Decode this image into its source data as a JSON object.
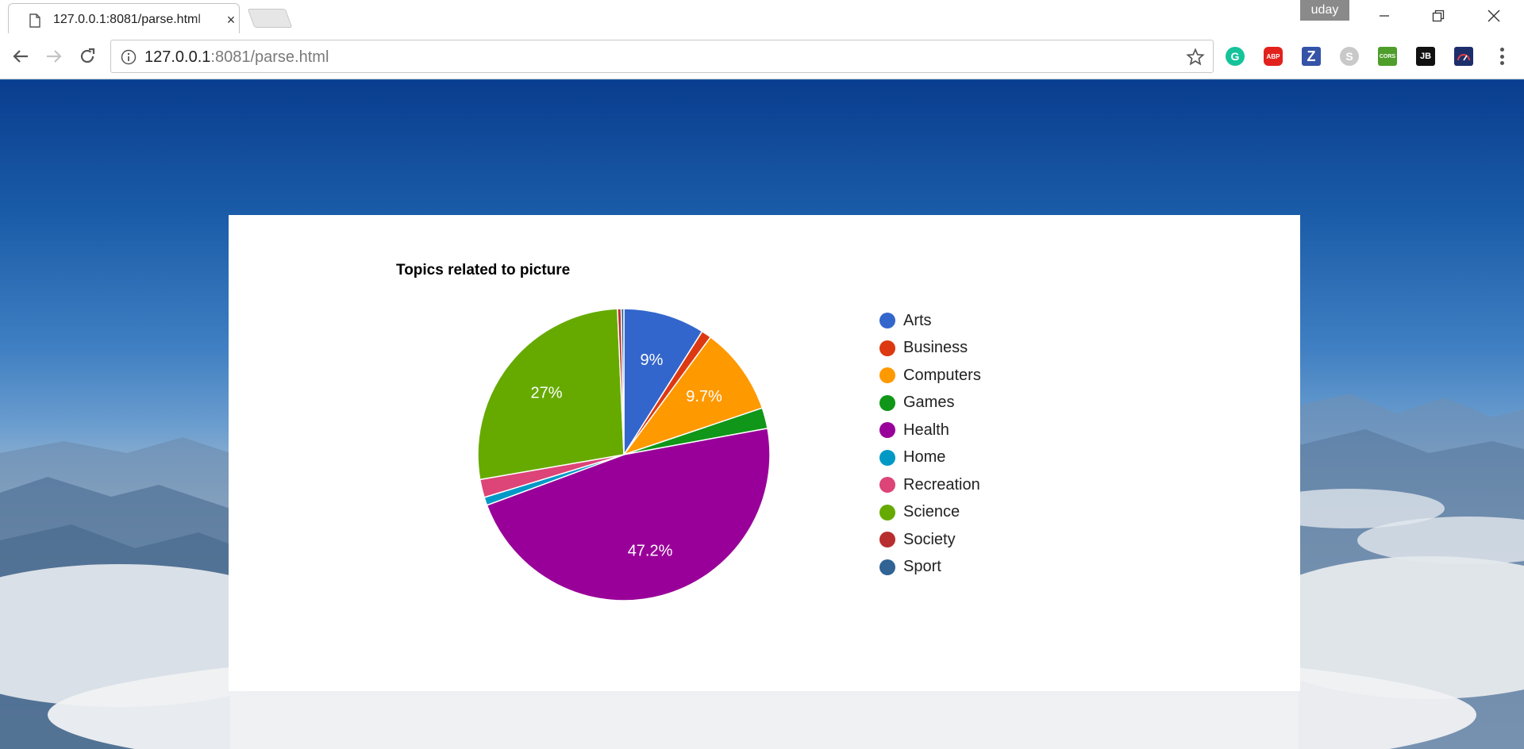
{
  "browser": {
    "tab_title": "127.0.0.1:8081/parse.html",
    "profile_name": "uday",
    "url_host": "127.0.0.1",
    "url_rest": ":8081/parse.html",
    "extensions": {
      "grammarly": "G",
      "abp": "ABP",
      "z": "Z",
      "skype": "S",
      "cors": "CORS",
      "jb": "JB"
    }
  },
  "chart_data": {
    "type": "pie",
    "title": "Topics related to picture",
    "categories": [
      "Arts",
      "Business",
      "Computers",
      "Games",
      "Health",
      "Home",
      "Recreation",
      "Science",
      "Society",
      "Sport"
    ],
    "values": [
      9.0,
      1.1,
      9.7,
      2.3,
      47.2,
      0.9,
      2.0,
      27.0,
      0.4,
      0.3
    ],
    "data_labels": [
      "9%",
      "",
      "9.7%",
      "",
      "47.2%",
      "",
      "",
      "27%",
      "",
      ""
    ],
    "colors": [
      "#3366cc",
      "#dc3912",
      "#ff9900",
      "#109618",
      "#990099",
      "#0099c6",
      "#dd4477",
      "#66aa00",
      "#b82e2e",
      "#316395"
    ],
    "legend_position": "right"
  }
}
